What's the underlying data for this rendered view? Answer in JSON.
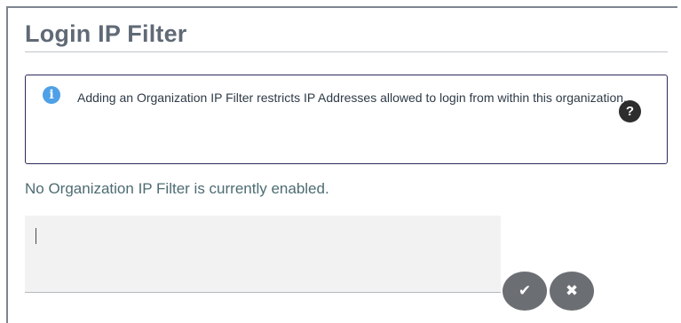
{
  "panel": {
    "title": "Login IP Filter"
  },
  "info": {
    "icon": "info-icon",
    "text": "Adding an Organization IP Filter restricts IP Addresses allowed to login from within this organization.",
    "help_icon": "question-icon",
    "help_glyph": "?",
    "info_glyph": "i"
  },
  "status": {
    "text": "No Organization IP Filter is currently enabled."
  },
  "ip_input": {
    "value": ""
  },
  "actions": {
    "confirm_icon": "check-icon",
    "confirm_glyph": "✔",
    "cancel_icon": "close-icon",
    "cancel_glyph": "✖"
  },
  "colors": {
    "accent": "#4fa0e6",
    "info_border": "#2b2a5c",
    "button_bg": "#6b6e73",
    "status_text": "#4d6c73"
  }
}
